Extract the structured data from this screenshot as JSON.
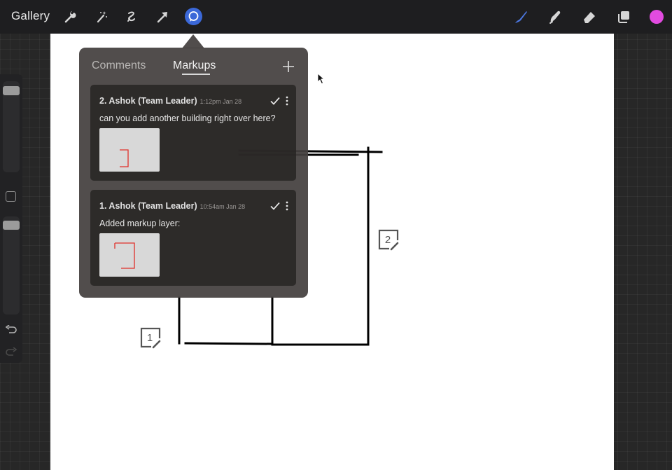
{
  "topbar": {
    "gallery_label": "Gallery",
    "left_tools": [
      {
        "name": "wrench-icon"
      },
      {
        "name": "magic-wand-icon"
      },
      {
        "name": "selection-icon"
      },
      {
        "name": "transform-arrow-icon"
      },
      {
        "name": "comment-bubble-icon",
        "active": true
      }
    ],
    "right_tools": [
      {
        "name": "brush-icon"
      },
      {
        "name": "smudge-icon"
      },
      {
        "name": "eraser-icon"
      },
      {
        "name": "layers-icon"
      }
    ],
    "active_color": "#e24be0",
    "active_tool_color": "#3b68d8"
  },
  "popover": {
    "tabs": [
      {
        "label": "Comments",
        "active": false
      },
      {
        "label": "Markups",
        "active": true
      }
    ],
    "add_icon": "plus-icon",
    "cards": [
      {
        "title": "2. Ashok (Team Leader)",
        "time": "1:12pm Jan 28",
        "body": "can you add another building right over here?"
      },
      {
        "title": "1. Ashok (Team Leader)",
        "time": "10:54am Jan 28",
        "body": "Added markup layer:"
      }
    ]
  },
  "canvas": {
    "pins": [
      {
        "number": "1"
      },
      {
        "number": "2"
      }
    ]
  },
  "colors": {
    "topbar_bg": "#1e1e20",
    "workspace_bg": "#272727",
    "canvas_bg": "#ffffff",
    "popover_bg": "#44403e",
    "markup_red": "#e0302a"
  }
}
